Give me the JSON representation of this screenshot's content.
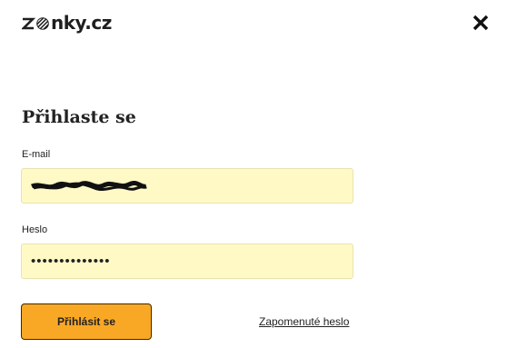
{
  "header": {
    "logo_text": "nky.cz",
    "logo_mark_icon": "zo-logo-mark-icon",
    "close_icon": "close-icon"
  },
  "login": {
    "title": "Přihlaste se",
    "email_label": "E-mail",
    "email_value": "",
    "email_redacted": true,
    "password_label": "Heslo",
    "password_value": "••••••••••••••",
    "submit_label": "Přihlásit se",
    "forgot_label": "Zapomenuté heslo"
  },
  "colors": {
    "field_background": "#fff9c6",
    "button_accent": "#f9a825",
    "text": "#222222"
  }
}
